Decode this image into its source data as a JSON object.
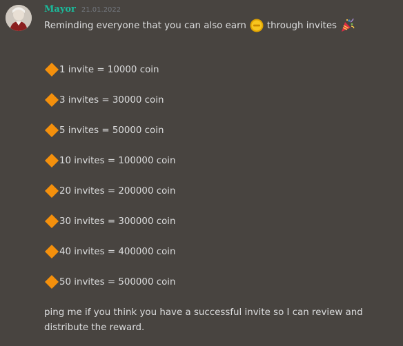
{
  "message": {
    "author": "Mayor",
    "timestamp": "21.01.2022",
    "intro_before": "Reminding everyone that you can also earn",
    "intro_after": "through invites",
    "icons": {
      "avatar": "avatar-image",
      "coin": "gold-coin-emoji",
      "party": "party-popper-emoji",
      "bullet": "large-orange-diamond-emoji"
    },
    "rewards": [
      "1 invite = 10000 coin",
      "3 invites = 30000 coin",
      "5 invites = 50000 coin",
      "10 invites = 100000 coin",
      "20 invites = 200000 coin",
      "30 invites = 300000 coin",
      "40 invites = 400000 coin",
      "50 invites = 500000 coin"
    ],
    "closing": "ping me if you think you have a successful invite so I can review and distribute the reward."
  },
  "colors": {
    "background": "#484440",
    "username": "#1abc9c",
    "text": "#dcddde",
    "timestamp": "#72767d",
    "diamond": "#f4900c"
  }
}
